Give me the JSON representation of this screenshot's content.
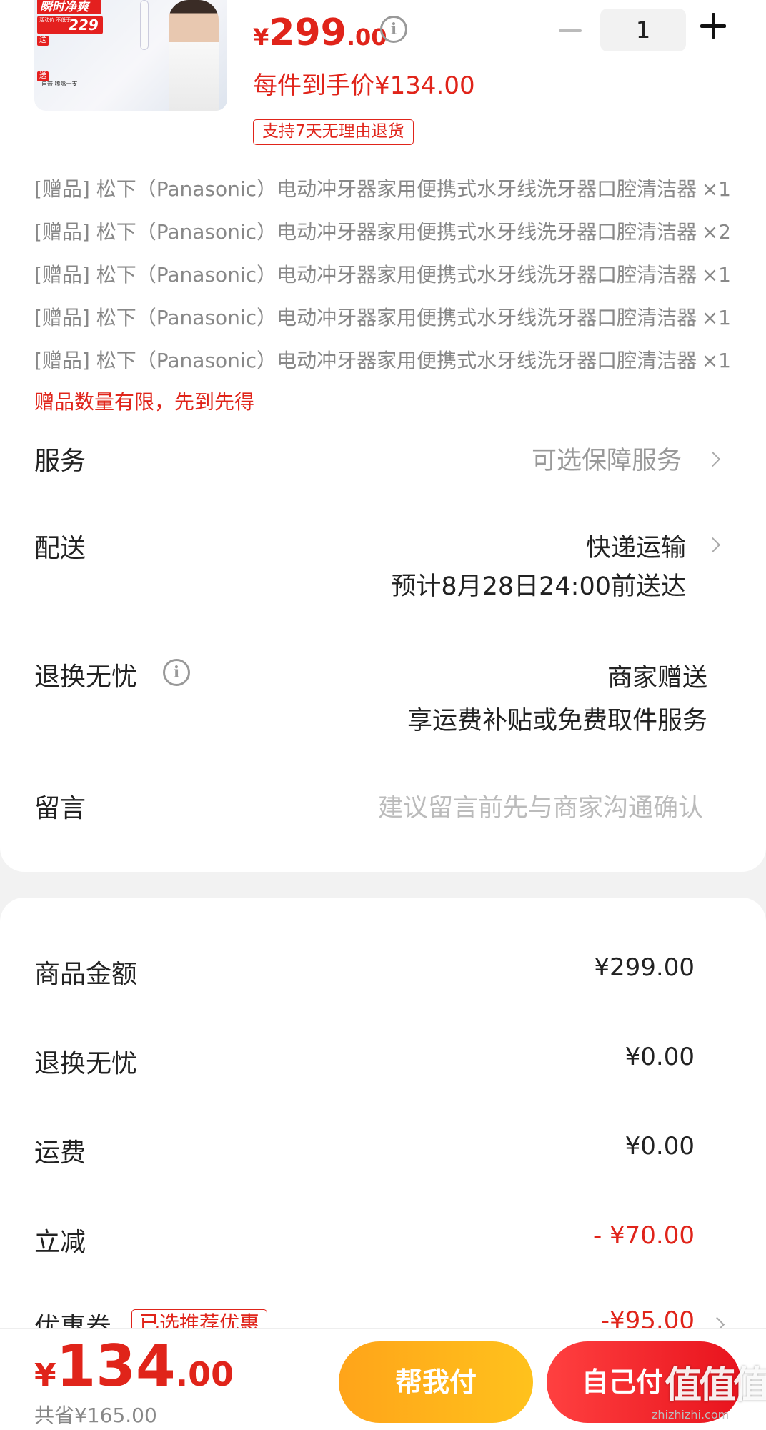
{
  "product": {
    "thumb_banner": "瞬时净爽",
    "thumb_price_small": "活动价 不低于",
    "thumb_price": "229",
    "thumb_gift_note": "自带 喷嘴一支",
    "price_currency": "¥",
    "price_int": "299",
    "price_dec": ".00",
    "quantity": "1",
    "unit_price": "每件到手价¥134.00",
    "return_badge": "支持7天无理由退货"
  },
  "gifts": [
    {
      "text": "[赠品] 松下（Panasonic）电动冲牙器家用便携式水牙线洗牙器口腔清洁器",
      "qty": "×1"
    },
    {
      "text": "[赠品] 松下（Panasonic）电动冲牙器家用便携式水牙线洗牙器口腔清洁器",
      "qty": "×2"
    },
    {
      "text": "[赠品] 松下（Panasonic）电动冲牙器家用便携式水牙线洗牙器口腔清洁器",
      "qty": "×1"
    },
    {
      "text": "[赠品] 松下（Panasonic）电动冲牙器家用便携式水牙线洗牙器口腔清洁器",
      "qty": "×1"
    },
    {
      "text": "[赠品] 松下（Panasonic）电动冲牙器家用便携式水牙线洗牙器口腔清洁器",
      "qty": "×1"
    }
  ],
  "gift_limit": "赠品数量有限，先到先得",
  "service": {
    "label": "服务",
    "value": "可选保障服务"
  },
  "delivery": {
    "label": "配送",
    "method": "快递运输",
    "eta": "预计8月28日24:00前送达"
  },
  "worry_free": {
    "label": "退换无忧",
    "value": "商家赠送",
    "desc": "享运费补贴或免费取件服务"
  },
  "message": {
    "label": "留言",
    "placeholder": "建议留言前先与商家沟通确认"
  },
  "summary": {
    "goods_label": "商品金额",
    "goods_value": "¥299.00",
    "worry_label": "退换无忧",
    "worry_value": "¥0.00",
    "shipping_label": "运费",
    "shipping_value": "¥0.00",
    "discount_label": "立减",
    "discount_value": "- ¥70.00",
    "coupon_label": "优惠券",
    "coupon_badge": "已选推荐优惠",
    "coupon_value": "-¥95.00"
  },
  "bottom": {
    "total_currency": "¥",
    "total_int": "134",
    "total_dec": ".00",
    "saved": "共省¥165.00",
    "help_pay": "帮我付",
    "self_pay": "自己付"
  },
  "watermark": {
    "main": "值值值",
    "sub": "zhizhizhi.com"
  },
  "colors": {
    "accent": "#e0241a",
    "help_button": "#ffb31b",
    "self_button": "#f02a2a",
    "background": "#f2f2f2"
  }
}
